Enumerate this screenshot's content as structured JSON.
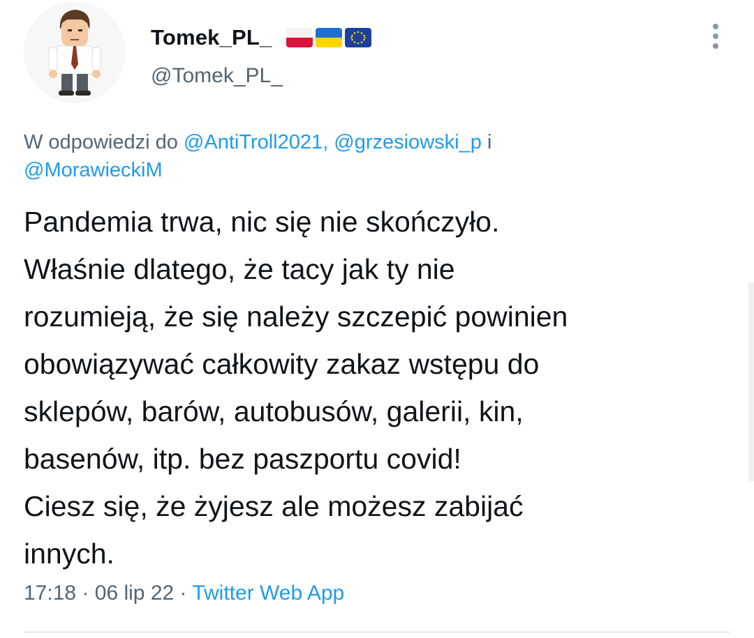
{
  "author": {
    "display_name": "Tomek_PL_",
    "handle": "@Tomek_PL_",
    "flags": [
      "poland-flag",
      "ukraine-flag",
      "eu-flag"
    ]
  },
  "reply": {
    "prefix": "W odpowiedzi do",
    "mentions": [
      "@AntiTroll2021,",
      "@grzesiowski_p",
      "@MorawieckiM"
    ],
    "conjunction": "i"
  },
  "tweet": {
    "lines": [
      "Pandemia trwa, nic się nie skończyło.",
      "Właśnie dlatego, że tacy jak ty nie",
      "rozumieją, że się należy szczepić powinien",
      "obowiązywać całkowity zakaz wstępu do",
      "sklepów, barów, autobusów, galerii, kin,",
      "basenów, itp. bez paszportu covid!",
      "Ciesz się, że żyjesz ale możesz zabijać",
      "innych."
    ]
  },
  "meta": {
    "time": "17:18",
    "date": "06 lip 22",
    "separator": "·",
    "source": "Twitter Web App"
  },
  "colors": {
    "text": "#0f1419",
    "secondary": "#536471",
    "link": "#1d9bf0",
    "divider": "#cfd9de"
  }
}
